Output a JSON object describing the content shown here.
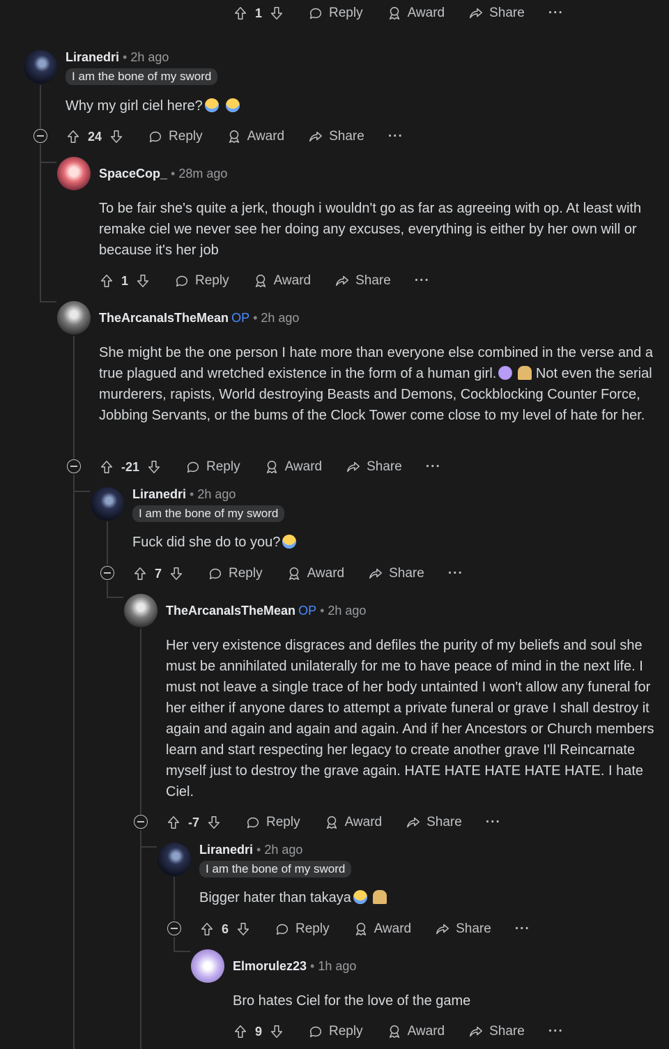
{
  "top_actions": {
    "score": "1",
    "reply": "Reply",
    "award": "Award",
    "share": "Share",
    "more": "···"
  },
  "comments": [
    {
      "user": "Liranedri",
      "op": "",
      "time": "2h ago",
      "flair": "I am the bone of my sword",
      "text": "Why my girl ciel here?",
      "score": "24",
      "reply": "Reply",
      "award": "Award",
      "share": "Share",
      "more": "···"
    },
    {
      "user": "SpaceCop_",
      "op": "",
      "time": "28m ago",
      "flair": "",
      "text": "To be fair she's quite a jerk, though i wouldn't go as far as agreeing with op. At least with remake ciel we never see her doing any excuses, everything is either by her own will or because it's her job",
      "score": "1",
      "reply": "Reply",
      "award": "Award",
      "share": "Share",
      "more": "···"
    },
    {
      "user": "TheArcanaIsTheMean",
      "op": "OP",
      "time": "2h ago",
      "flair": "",
      "text_a": "She might be the one person I hate more than everyone else combined in the verse and a true plagued and wretched existence in the form of a human girl.",
      "text_b": "Not even the serial murderers, rapists, World destroying Beasts and Demons, Cockblocking Counter Force, Jobbing Servants, or the bums of the Clock Tower come close to my level of hate for her.",
      "score": "-21",
      "reply": "Reply",
      "award": "Award",
      "share": "Share",
      "more": "···"
    },
    {
      "user": "Liranedri",
      "op": "",
      "time": "2h ago",
      "flair": "I am the bone of my sword",
      "text": "Fuck did she do to you?",
      "score": "7",
      "reply": "Reply",
      "award": "Award",
      "share": "Share",
      "more": "···"
    },
    {
      "user": "TheArcanaIsTheMean",
      "op": "OP",
      "time": "2h ago",
      "flair": "",
      "text": "Her very existence disgraces and defiles the purity of my beliefs and soul she must be annihilated unilaterally for me to have peace of mind in the next life. I must not leave a single trace of her body untainted I won't allow any funeral for her either if anyone dares to attempt a private funeral or grave I shall destroy it again and again and again and again. And if her Ancestors or Church members learn and start respecting her legacy to create another grave I'll Reincarnate myself just to destroy the grave again. HATE HATE HATE HATE HATE. I hate Ciel.",
      "score": "-7",
      "reply": "Reply",
      "award": "Award",
      "share": "Share",
      "more": "···"
    },
    {
      "user": "Liranedri",
      "op": "",
      "time": "2h ago",
      "flair": "I am the bone of my sword",
      "text": "Bigger hater than takaya",
      "score": "6",
      "reply": "Reply",
      "award": "Award",
      "share": "Share",
      "more": "···"
    },
    {
      "user": "Elmorulez23",
      "op": "",
      "time": "1h ago",
      "flair": "",
      "text": "Bro hates Ciel for the love of the game",
      "score": "9",
      "reply": "Reply",
      "award": "Award",
      "share": "Share",
      "more": "···"
    }
  ]
}
